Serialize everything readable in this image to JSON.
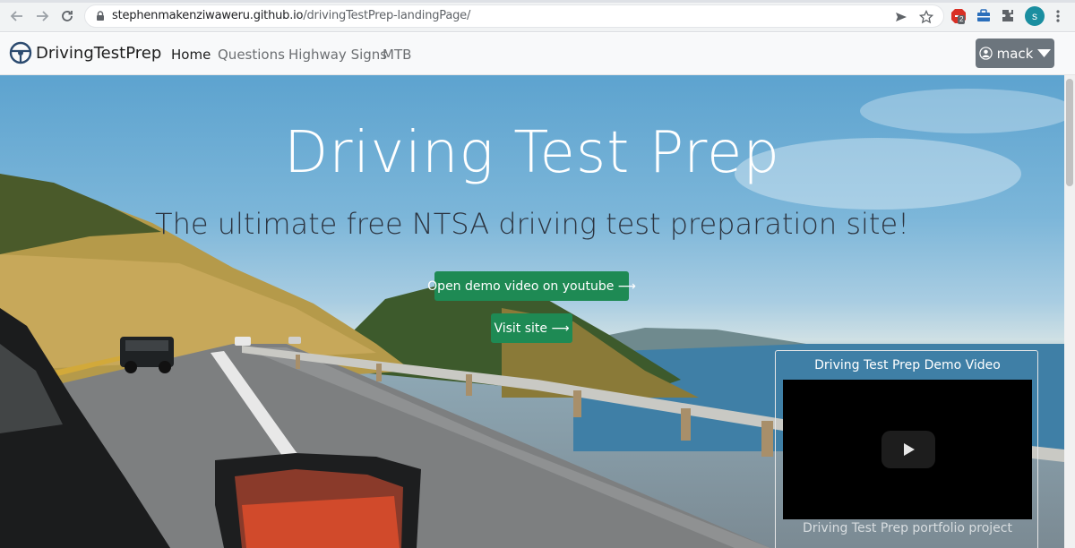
{
  "browser": {
    "url_host": "stephenmakenziwaweru.github.io",
    "url_path": "/drivingTestPrep-landingPage/",
    "profile_initial": "s",
    "extension_badge": "2"
  },
  "navbar": {
    "brand": "DrivingTestPrep",
    "links": [
      "Home",
      "Questions",
      "Highway Signs",
      "MTB"
    ],
    "user_label": "mack"
  },
  "hero": {
    "title": "Driving Test Prep",
    "subtitle": "The ultimate free NTSA driving test preparation site!",
    "youtube_button": "Open demo video on youtube ⟶",
    "visit_button": "Visit site ⟶"
  },
  "video": {
    "title": "Driving Test Prep Demo Video",
    "caption": "Driving Test Prep portfolio project"
  },
  "colors": {
    "button_green": "#1e8a54",
    "user_button": "#6c757d",
    "navbar_bg": "#f8f9fa"
  }
}
